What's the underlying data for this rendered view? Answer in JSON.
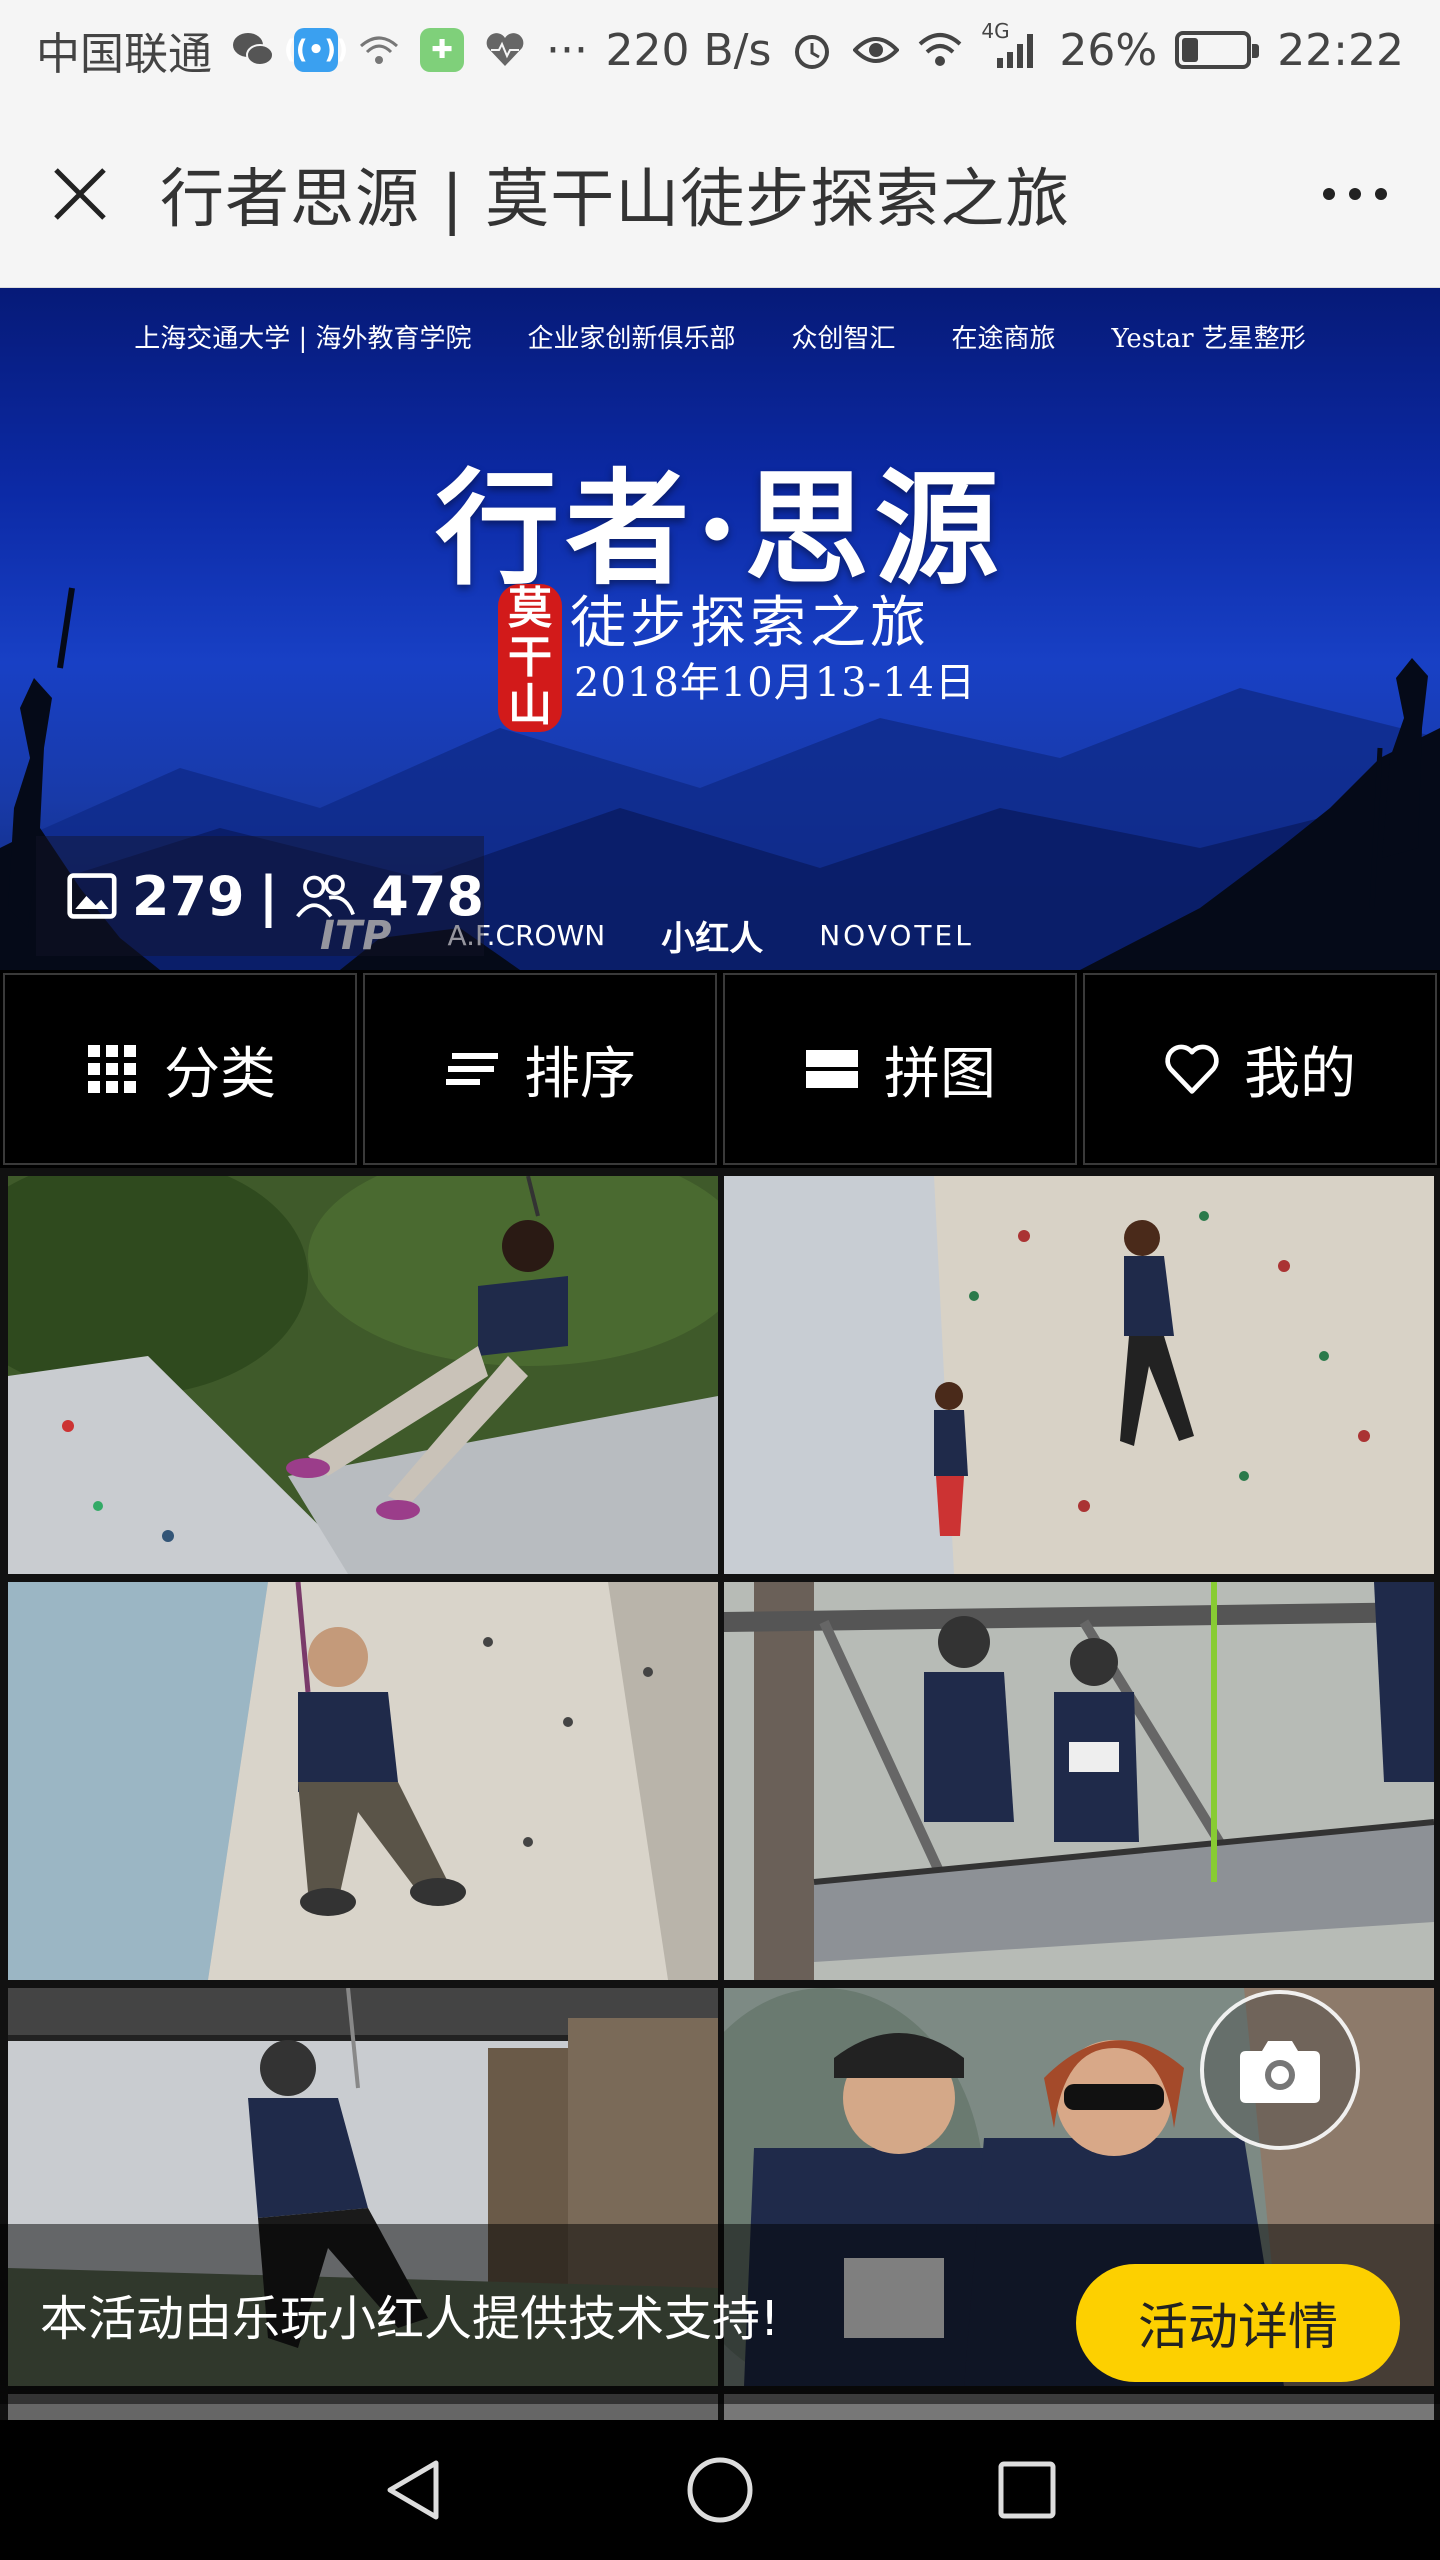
{
  "status_bar": {
    "carrier": "中国联通",
    "speed": "220 B/s",
    "network": "4G",
    "battery_percent": "26%",
    "battery_level": 0.26,
    "time": "22:22"
  },
  "title_bar": {
    "title": "行者思源 | 莫干山徒步探索之旅"
  },
  "banner": {
    "sponsors_top": [
      "上海交通大学 | 海外教育学院",
      "企业家创新俱乐部",
      "众创智汇",
      "在途商旅",
      "Yestar 艺星整形"
    ],
    "title": "行者·思源",
    "seal": [
      "莫",
      "干",
      "山"
    ],
    "subtitle": "徒步探索之旅",
    "date": "2018年10月13-14日",
    "sponsors_bottom": [
      "ITP",
      "A.F.CROWN",
      "小红人",
      "NOVOTEL"
    ],
    "photo_count": "279",
    "separator": "|",
    "visitor_count": "478"
  },
  "toolbar": [
    {
      "label": "分类",
      "icon": "grid-icon"
    },
    {
      "label": "排序",
      "icon": "sort-icon"
    },
    {
      "label": "拼图",
      "icon": "collage-icon"
    },
    {
      "label": "我的",
      "icon": "heart-icon"
    }
  ],
  "photos": [
    {
      "subject": "climber swinging on rope",
      "position": "row1-left"
    },
    {
      "subject": "climbers on wall",
      "position": "row1-right"
    },
    {
      "subject": "man on climbing wall",
      "position": "row2-left"
    },
    {
      "subject": "people on high platform",
      "position": "row2-right"
    },
    {
      "subject": "man on zipline",
      "position": "row3-left"
    },
    {
      "subject": "two women looking up",
      "position": "row3-right"
    }
  ],
  "footer": {
    "support_text": "本活动由乐玩小红人提供技术支持!",
    "detail_button": "活动详情"
  },
  "colors": {
    "accent": "#fdd000",
    "banner_blue": "#1840c5"
  }
}
